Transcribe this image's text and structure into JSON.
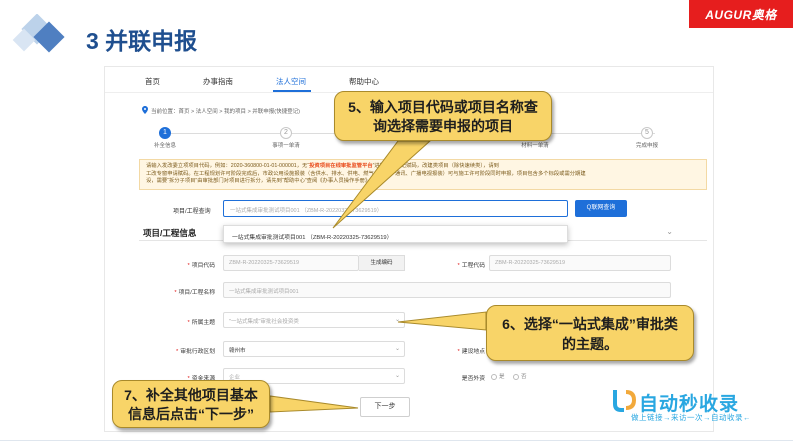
{
  "slide": {
    "title": "3 并联申报",
    "logo": "AUGUR奥格"
  },
  "nav": {
    "items": [
      "首页",
      "办事指南",
      "法人空间",
      "帮助中心"
    ],
    "active_index": 2
  },
  "breadcrumb": "当前位置：首页 > 法人空间 > 我的项目 > 并联申报(快捷登记)",
  "steps": [
    {
      "num": "1",
      "label": "补全信息",
      "active": true
    },
    {
      "num": "2",
      "label": "事项一单清",
      "active": false
    },
    {
      "num": "3",
      "label": "",
      "active": false
    },
    {
      "num": "4",
      "label": "材料一单清",
      "active": false
    },
    {
      "num": "5",
      "label": "完成申报",
      "active": false
    }
  ],
  "notice": {
    "line1_pre": "请输入发改委立项项目代码，例如：2020-360800-01-01-000001，无",
    "line1_highlight": "投资项目在线审批监管平台",
    "line1_post": "”进行项目登记赋码，改建类项目（除快速续类），请到",
    "line2": "工改专窗申请赋码。在工程规划许可阶段完成后，市政公用设施报装（含供水、排水、供电、燃气、热力、通讯、广播电视报装）可与施工许可阶段同时申报，项目包含多个标段或需分期建",
    "line3": "设，需要“拆分子项目”由审批部门对项目进行拆分，请先到“帮助中心”查阅《办事人员操作手册》。"
  },
  "query": {
    "label": "项目/工程查询",
    "value": "一站式集成审批测试项目001 （ZBM-R-20220325-73629519）",
    "button": "Q联网查询"
  },
  "dropdown_option": "一站式集成审批测试项目001 （ZBM-R-20220325-73629519）",
  "section": {
    "title": "项目/工程信息",
    "chevron": "⌄"
  },
  "form": {
    "project_code_label": "项目代码",
    "project_code_value": "ZBM-R-20220325-73629519",
    "generate_button": "生成编码",
    "engineering_code_label": "工程代码",
    "engineering_code_value": "ZBM-R-20220325-73629519",
    "project_name_label": "项目/工程名称",
    "project_name_value": "一站式集成审批测试项目001",
    "theme_label": "所属主题",
    "theme_value": "\"一站式集成\"审批社会投资类",
    "region_label": "审批行政区划",
    "region_value": "赣州市",
    "location_label": "建设地点",
    "fund_label": "资金来源",
    "fund_value": "企业",
    "abroad_label": "是否外资",
    "abroad_yes": "是",
    "abroad_no": "否",
    "next_button": "下一步"
  },
  "callouts": {
    "c5": "5、输入项目代码或项目名称查询选择需要申报的项目",
    "c6": "6、选择“一站式集成”审批类的主题。",
    "c7": "7、补全其他项目基本信息后点击“下一步”"
  },
  "watermark": {
    "text": "自动秒收录",
    "sub": "做上链接→来访一次→自动收录←"
  },
  "colors": {
    "accent": "#1e6fd9",
    "title": "#1f4f8f",
    "callout": "#f8d468",
    "logo_bg": "#e61e1e"
  }
}
